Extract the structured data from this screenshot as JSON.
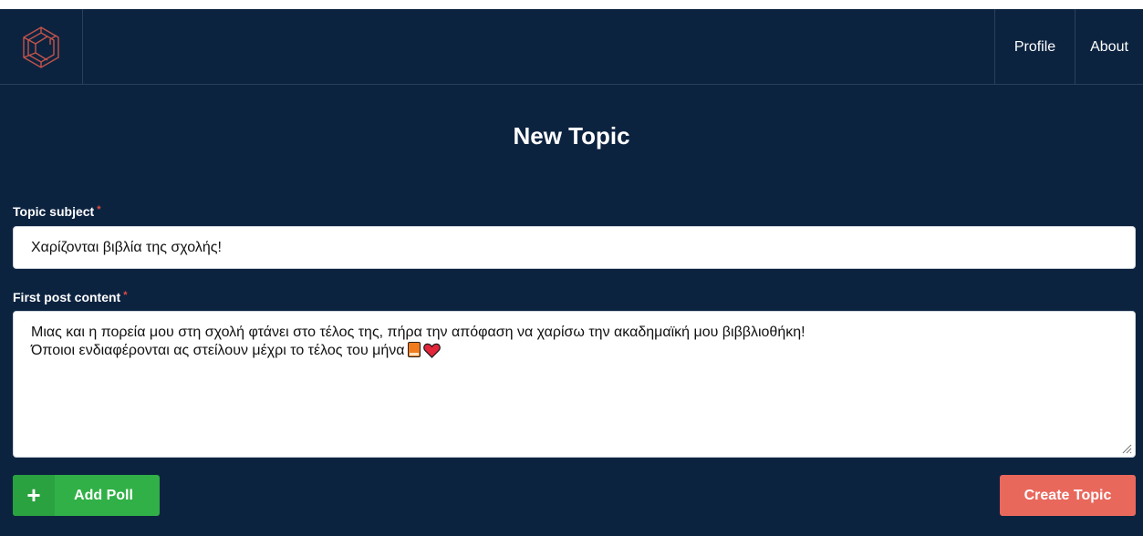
{
  "nav": {
    "logo_icon": "hexagon-c-logo",
    "links": {
      "profile": "Profile",
      "about": "About"
    }
  },
  "page": {
    "title": "New Topic"
  },
  "form": {
    "subject_label": "Topic subject",
    "subject_value": "Χαρίζονται βιβλία της σχολής!",
    "content_label": "First post content",
    "required_mark": "*",
    "content_lines": [
      "Μιας και η πορεία μου στη σχολή φτάνει στο τέλος της, πήρα την απόφαση να χαρίσω την ακαδημαϊκή μου βιββλιοθήκη!",
      "Όποιοι ενδιαφέρονται ας  στείλουν μέχρι το τέλος του μήνα"
    ],
    "content_emojis": [
      "book-emoji",
      "heart-emoji"
    ]
  },
  "actions": {
    "add_poll_icon": "+",
    "add_poll_label": "Add Poll",
    "create_label": "Create Topic"
  },
  "colors": {
    "background": "#0c2340",
    "accent_green": "#30b046",
    "accent_coral": "#e9685c",
    "required": "#e64b3c"
  }
}
